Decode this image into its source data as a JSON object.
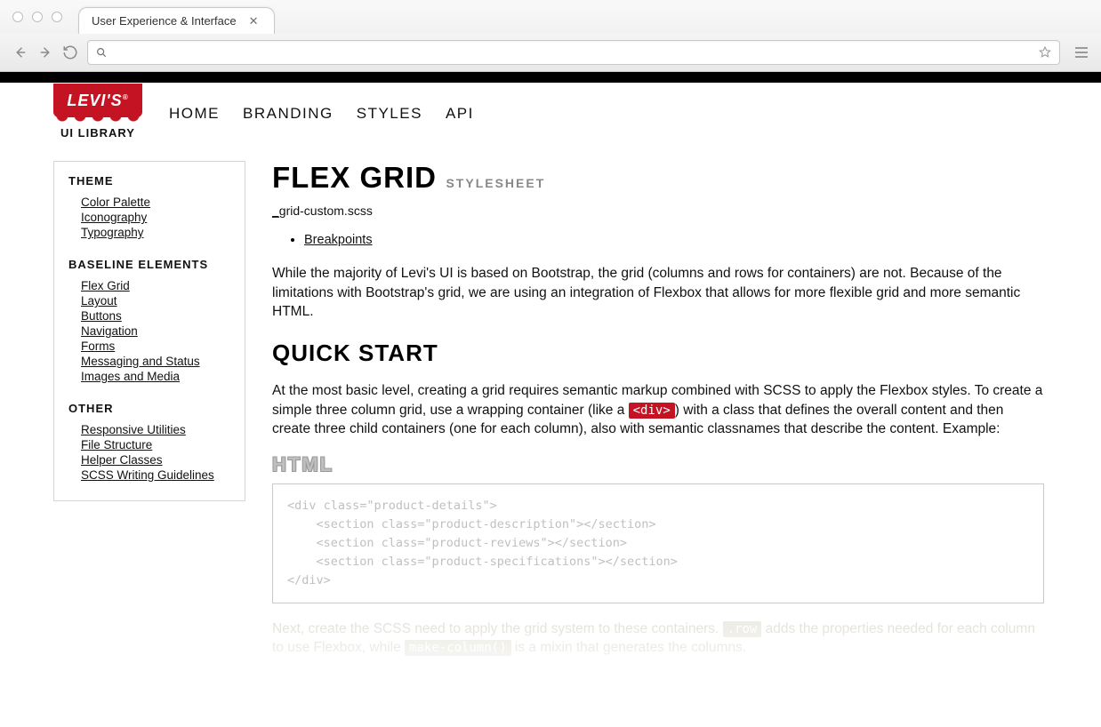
{
  "browser": {
    "tab_title": "User Experience & Interface",
    "address": ""
  },
  "logo": {
    "brand": "LEVI'S",
    "library_label": "UI LIBRARY"
  },
  "nav": {
    "items": [
      "HOME",
      "BRANDING",
      "STYLES",
      "API"
    ]
  },
  "sidebar": {
    "groups": [
      {
        "title": "THEME",
        "items": [
          "Color Palette",
          "Iconography",
          "Typography"
        ]
      },
      {
        "title": "BASELINE ELEMENTS",
        "items": [
          "Flex Grid",
          "Layout",
          "Buttons",
          "Navigation",
          "Forms",
          "Messaging and Status",
          "Images and Media"
        ]
      },
      {
        "title": "OTHER",
        "items": [
          "Responsive Utilities",
          "File Structure",
          "Helper Classes",
          "SCSS Writing Guidelines"
        ]
      }
    ]
  },
  "main": {
    "title": "FLEX GRID",
    "subtitle": "STYLESHEET",
    "filename_a": "_g",
    "filename_b": "rid-custom.scss",
    "toc": [
      "Breakpoints"
    ],
    "intro": "While the majority of Levi's UI is based on Bootstrap, the grid (columns and rows for containers) are not. Because of the limitations with Bootstrap's grid, we are using an integration of Flexbox that allows for more flexible grid and more semantic HTML.",
    "quickstart_heading": "QUICK START",
    "qs_para_a": "At the most basic level, creating a grid requires semantic markup combined with SCSS to apply the Flexbox styles. To create a simple three column grid, use a wrapping container (like a ",
    "qs_code": "<div>",
    "qs_para_b": ") with a class that defines the overall content and then create three child containers (one for each column), also with semantic classnames that describe the content. Example:",
    "html_heading": "HTML",
    "code_block": "<div class=\"product-details\">\n    <section class=\"product-description\"></section>\n    <section class=\"product-reviews\"></section>\n    <section class=\"product-specifications\"></section>\n</div>",
    "faded_a": "Next, create the SCSS need to apply the grid system to these containers. ",
    "faded_code1": ".row",
    "faded_b": " adds the properties needed for each column to use Flexbox, while ",
    "faded_code2": "make-column()",
    "faded_c": " is a mixin that generates the columns."
  }
}
